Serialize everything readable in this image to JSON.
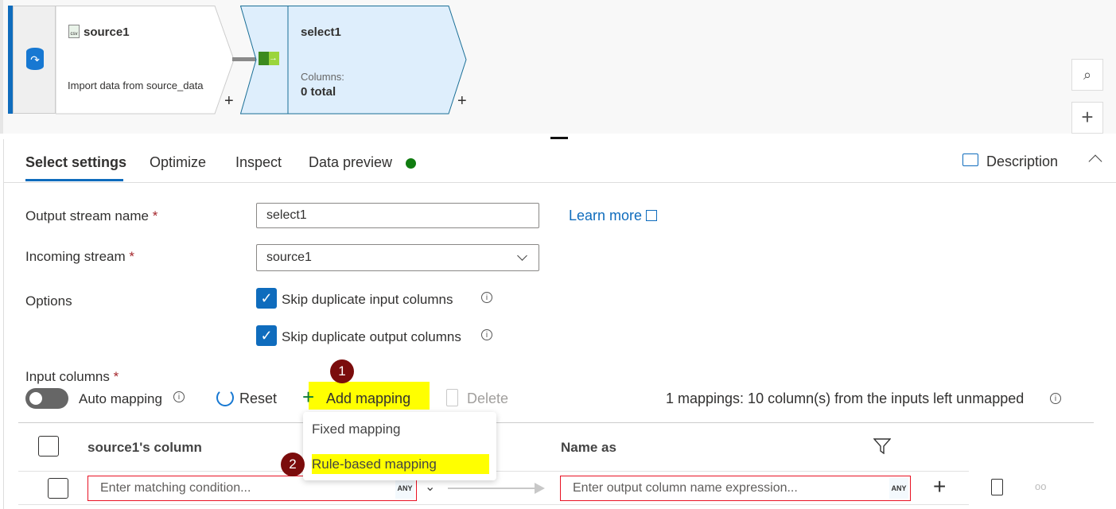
{
  "canvas": {
    "source_node": {
      "title": "source1",
      "description": "Import data from source_data",
      "add": "+"
    },
    "select_node": {
      "title": "select1",
      "columns_label": "Columns:",
      "columns_value": "0 total",
      "add": "+"
    },
    "zoom_search": "⌕",
    "zoom_add": "+"
  },
  "tabs": [
    {
      "label": "Select settings",
      "active": true
    },
    {
      "label": "Optimize"
    },
    {
      "label": "Inspect"
    },
    {
      "label": "Data preview"
    }
  ],
  "description_label": "Description",
  "form": {
    "output_stream_label": "Output stream name",
    "output_stream_value": "select1",
    "learn_more": "Learn more",
    "incoming_stream_label": "Incoming stream",
    "incoming_stream_value": "source1",
    "options_label": "Options",
    "skip_input": "Skip duplicate input columns",
    "skip_output": "Skip duplicate output columns",
    "required": "*"
  },
  "input_columns": {
    "label": "Input columns",
    "auto_mapping": "Auto mapping",
    "reset": "Reset",
    "add_mapping": "Add mapping",
    "delete": "Delete",
    "summary": "1 mappings: 10 column(s) from the inputs left unmapped",
    "menu": [
      "Fixed mapping",
      "Rule-based mapping"
    ],
    "badges": [
      "1",
      "2"
    ],
    "col_source": "source1's column",
    "col_name_as": "Name as",
    "condition_placeholder": "Enter matching condition...",
    "output_placeholder": "Enter output column name expression...",
    "any": "ANY"
  },
  "colors": {
    "accent": "#0f6cbd",
    "highlight": "#ffff00",
    "badge": "#7b0c0c",
    "error": "#e81123",
    "status_dot": "#107c10"
  }
}
